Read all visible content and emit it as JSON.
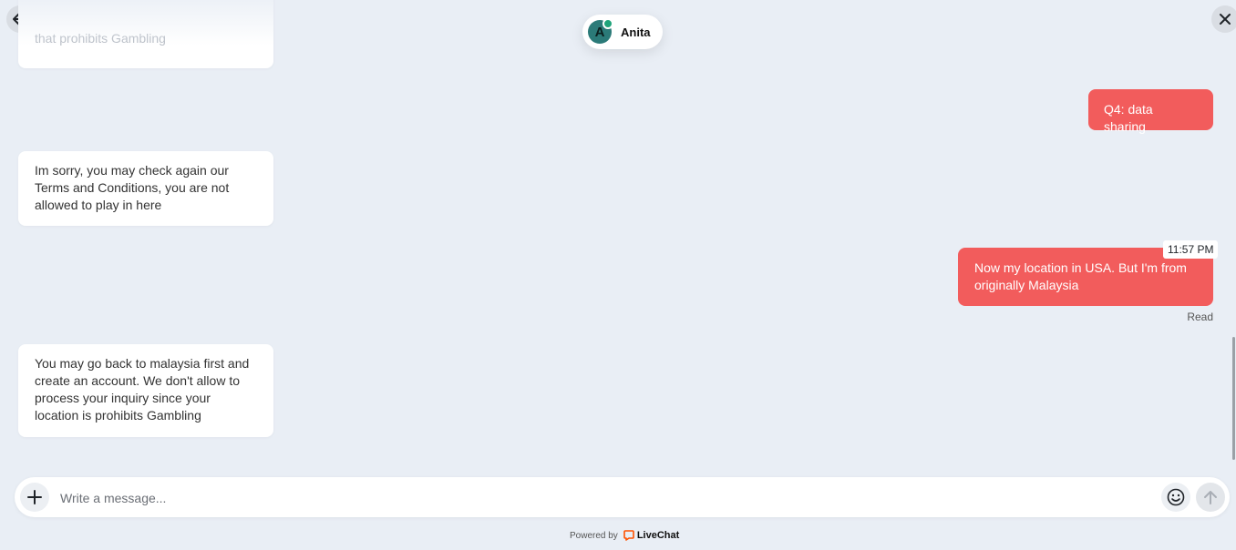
{
  "header": {
    "agent_name": "Anita",
    "agent_initial": "A"
  },
  "messages": [
    {
      "side": "incoming",
      "text": "that prohibits Gambling"
    },
    {
      "side": "outgoing",
      "text": "Q4: data sharing"
    },
    {
      "side": "incoming",
      "text": "Im sorry, you may check again our Terms and Conditions, you are not allowed to play in here"
    },
    {
      "side": "outgoing",
      "text": "Now my location in USA. But I'm from originally Malaysia",
      "time": "11:57 PM",
      "status": "Read"
    },
    {
      "side": "incoming",
      "text": "You may go back to malaysia first and create an account. We don't allow to process your inquiry since your location is prohibits Gambling"
    }
  ],
  "composer": {
    "placeholder": "Write a message..."
  },
  "footer": {
    "powered_by": "Powered by",
    "brand": "LiveChat"
  },
  "colors": {
    "outgoing_bubble": "#f25c5c",
    "background": "#e9eef5",
    "brand_orange": "#ff5100"
  },
  "icons": {
    "back": "arrow-left-icon",
    "more": "more-dots-icon",
    "close": "close-icon",
    "add": "plus-icon",
    "emoji": "smiley-icon",
    "send": "arrow-up-icon"
  }
}
